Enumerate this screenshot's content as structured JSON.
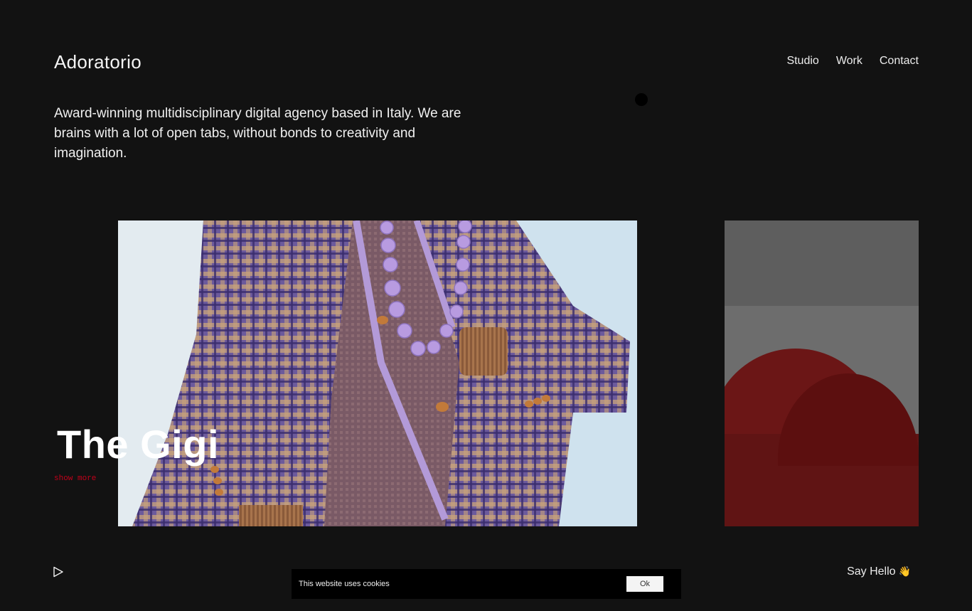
{
  "header": {
    "logo": "Adoratorio",
    "nav": [
      "Studio",
      "Work",
      "Contact"
    ]
  },
  "intro": {
    "text": "Award-winning multidisciplinary digital agency based in Italy. We are brains with a lot of open tabs, without bonds to creativity and imagination."
  },
  "project": {
    "title": "The Gigi",
    "show_more": "show more"
  },
  "footer": {
    "say_hello": "Say Hello",
    "wave_emoji": "👋"
  },
  "cookie_banner": {
    "text": "This website uses cookies",
    "ok_label": "Ok"
  },
  "icons": {
    "play": "play-icon",
    "cursor": "cursor-dot"
  },
  "colors": {
    "background": "#121212",
    "accent_red": "#c4001a",
    "text": "#f2f2f2"
  }
}
